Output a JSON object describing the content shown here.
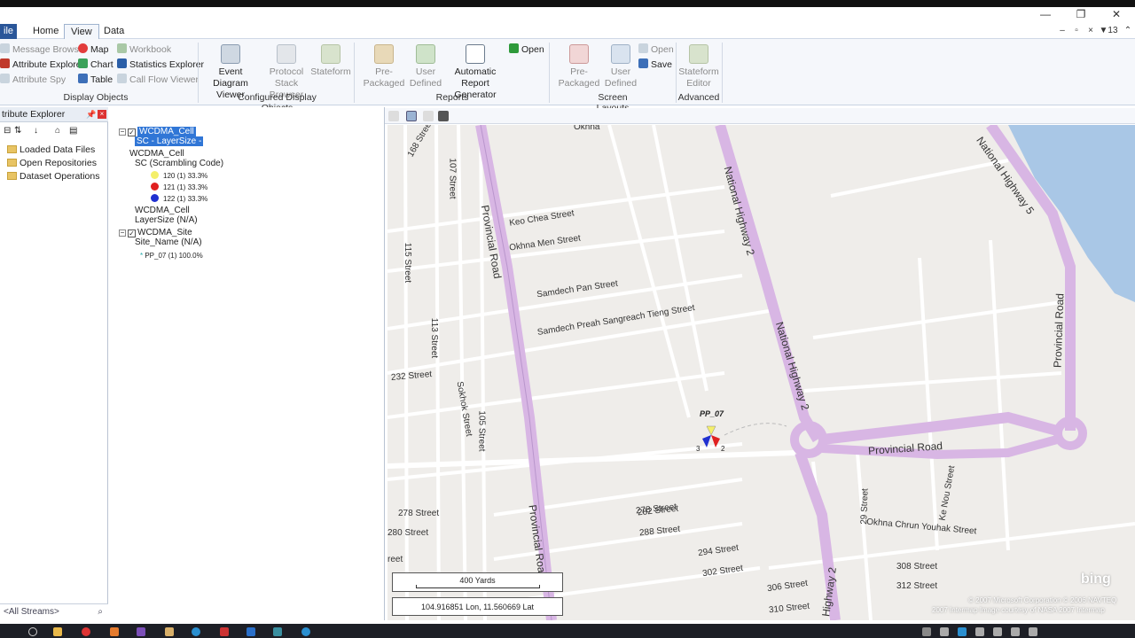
{
  "window": {
    "minimize": "—",
    "restore": "❐",
    "close": "✕"
  },
  "menu": {
    "file": "ile",
    "tabs": [
      "Home",
      "View",
      "Data"
    ],
    "right_counter": "13"
  },
  "ribbon": {
    "display_objects": {
      "label": "Display Objects",
      "items": [
        "Message Browser",
        "Map",
        "Workbook",
        "Attribute Explorer",
        "Chart",
        "Statistics Explorer",
        "Attribute Spy",
        "Table",
        "Call Flow Viewer"
      ]
    },
    "configured": {
      "label": "Configured Display Objects",
      "event_diagram": "Event Diagram Viewer",
      "protocol": "Protocol Stack Browser",
      "stateform": "Stateform"
    },
    "reports": {
      "label": "Reports",
      "prepackaged": "Pre-Packaged",
      "user_defined": "User Defined",
      "automatic": "Automatic Report Generator",
      "open": "Open"
    },
    "screen_layouts": {
      "label": "Screen Layouts",
      "prepackaged": "Pre-Packaged",
      "user_defined": "User Defined",
      "open": "Open",
      "save": "Save"
    },
    "advanced": {
      "label": "Advanced",
      "stateform_editor": "Stateform Editor"
    }
  },
  "left_panel": {
    "title": "tribute Explorer",
    "items": [
      "Loaded Data Files",
      "Open Repositories",
      "Dataset Operations"
    ],
    "streams": "<All Streams>"
  },
  "layers": {
    "cell_layer": "WCDMA_Cell",
    "cell_layer_sub": "SC - LayerSize -",
    "cell_group": "WCDMA_Cell",
    "sc_label": "SC (Scrambling Code)",
    "sc_items": [
      {
        "label": "120 (1) 33.3%",
        "color": "#f4ef6a"
      },
      {
        "label": "121 (1) 33.3%",
        "color": "#e02020"
      },
      {
        "label": "122 (1) 33.3%",
        "color": "#2030d0"
      }
    ],
    "cell_group2": "WCDMA_Cell",
    "layersize": "LayerSize (N/A)",
    "site_layer": "WCDMA_Site",
    "site_name": "Site_Name (N/A)",
    "site_item": "PP_07 (1) 100.0%"
  },
  "map": {
    "streets": [
      "Okhna",
      "168 Street",
      "107 Street",
      "Keo Chea Street",
      "Okhna Men Street",
      "Samdech Pan Street",
      "Samdech Preah Sangreach Tieng Street",
      "115 Street",
      "113 Street",
      "232 Street",
      "105 Street",
      "Sokhok Street",
      "278 Street",
      "280 Street",
      "282 Street",
      "288 Street",
      "294 Street",
      "302 Street",
      "306 Street",
      "310 Street",
      "308 Street",
      "312 Street",
      "29 Street",
      "Ke Nou Street",
      "Okhna Chrun Youhak Street",
      "113 Street",
      "111 Street",
      "115 Street",
      "reet",
      "reet"
    ],
    "roads": [
      "Provincial Road",
      "National Highway 2",
      "National Highway 5",
      "Provincial Road",
      "Provincial Road",
      "Provincial Roa",
      "Highway 2"
    ],
    "site_label": "PP_07",
    "sector_a": "3",
    "sector_b": "2",
    "scale": "400 Yards",
    "coords": "104.916851 Lon, 11.560669 Lat",
    "copyright1": "© 2007 Microsoft Corporation   © 2006 NAVTEQ",
    "copyright2": "2007 Intermap  Image courtesy of NASA   2007 Intermap",
    "bing": "bing"
  }
}
